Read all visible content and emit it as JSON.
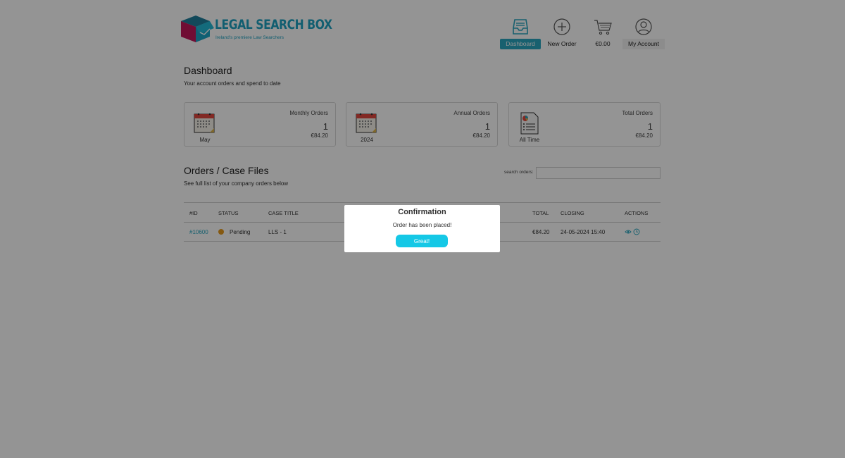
{
  "brand": {
    "name": "LEGAL SEARCH BOX",
    "tagline": "Ireland's premiere Law Searchers"
  },
  "nav": {
    "items": [
      {
        "label": "Dashboard",
        "icon": "inbox-tray-icon",
        "active": true
      },
      {
        "label": "New Order",
        "icon": "plus-circle-icon"
      },
      {
        "label": "€0.00",
        "icon": "cart-icon"
      },
      {
        "label": "My Account",
        "icon": "user-circle-icon"
      }
    ]
  },
  "dashboard": {
    "title": "Dashboard",
    "subtitle": "Your account orders and spend to date"
  },
  "cards": [
    {
      "icon": "calendar-icon",
      "label": "May",
      "title": "Monthly Orders",
      "count": "1",
      "amount": "€84.20"
    },
    {
      "icon": "calendar-icon",
      "label": "2024",
      "title": "Annual Orders",
      "count": "1",
      "amount": "€84.20"
    },
    {
      "icon": "report-icon",
      "label": "All Time",
      "title": "Total Orders",
      "count": "1",
      "amount": "€84.20"
    }
  ],
  "orders": {
    "title": "Orders / Case Files",
    "subtitle": "See full list of your company orders below",
    "search_label": "search orders:",
    "search_value": "",
    "columns": [
      "#ID",
      "STATUS",
      "CASE TITLE",
      "TOTAL",
      "CLOSING",
      "ACTIONS"
    ],
    "rows": [
      {
        "id": "#10600",
        "status": "Pending",
        "case_title": "LLS - 1",
        "total": "€84.20",
        "closing": "24-05-2024 15:40"
      }
    ]
  },
  "colors": {
    "accent": "#2aa6bf",
    "button": "#15c8e6",
    "pending": "#e69a1e",
    "overlay": "rgba(0,0,0,0.42)"
  },
  "modal": {
    "title": "Confirmation",
    "message": "Order has been placed!",
    "button_label": "Great!"
  }
}
